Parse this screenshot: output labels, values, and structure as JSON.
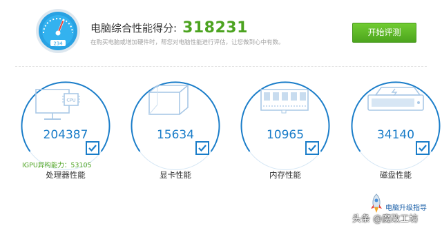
{
  "header": {
    "score_label": "电脑综合性能得分:",
    "score_value": "318231",
    "subtitle": "在购买电脑或增加硬件时，帮您对电脑性能进行评估，让您做到心中有数。",
    "gauge_readout": "234",
    "gauge_icon": "speedometer-icon"
  },
  "actions": {
    "start_label": "开始评测"
  },
  "components": [
    {
      "id": "cpu",
      "score": "204387",
      "name": "处理器性能",
      "icon": "cpu-monitor-icon",
      "chip_label": "CPU"
    },
    {
      "id": "gpu",
      "score": "15634",
      "name": "显卡性能",
      "icon": "graphics-card-cube-icon"
    },
    {
      "id": "memory",
      "score": "10965",
      "name": "内存性能",
      "icon": "memory-stick-icon"
    },
    {
      "id": "disk",
      "score": "34140",
      "name": "磁盘性能",
      "icon": "hard-disk-icon"
    }
  ],
  "igpu": {
    "text": "IGPU异构能力：53105"
  },
  "footer": {
    "upgrade_label": "电脑升级指导",
    "watermark": "头条 @魔改工坊"
  },
  "colors": {
    "accent_blue": "#1a7dc9",
    "score_green": "#4ca320",
    "button_green": "#5fb929",
    "icon_line": "#a9c8e6"
  }
}
